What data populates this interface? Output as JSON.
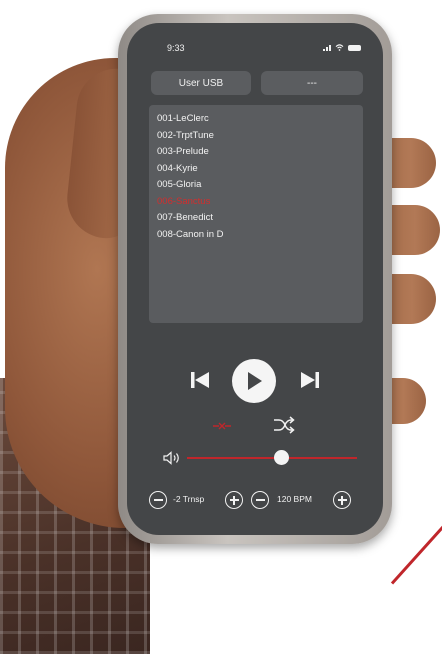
{
  "status_bar": {
    "time": "9:33"
  },
  "sources": {
    "left_label": "User USB",
    "right_label": "---"
  },
  "playlist": {
    "active_index": 5,
    "tracks": [
      "001-LeClerc",
      "002-TrptTune",
      "003-Prelude",
      "004-Kyrie",
      "005-Gloria",
      "006-Sanctus",
      "007-Benedict",
      "008-Canon in D"
    ]
  },
  "transport": {
    "prev_icon": "skip-previous-icon",
    "play_icon": "play-icon",
    "next_icon": "skip-next-icon",
    "loop_icon": "loop-icon",
    "shuffle_icon": "shuffle-icon"
  },
  "volume": {
    "icon": "speaker-icon",
    "level": 0.55
  },
  "transpose": {
    "label": "-2 Trnsp"
  },
  "tempo": {
    "label": "120 BPM"
  },
  "colors": {
    "accent": "#c0262b",
    "active_track": "#d22e2e",
    "screen_bg": "#444648",
    "panel_bg": "#5a5c5f"
  }
}
